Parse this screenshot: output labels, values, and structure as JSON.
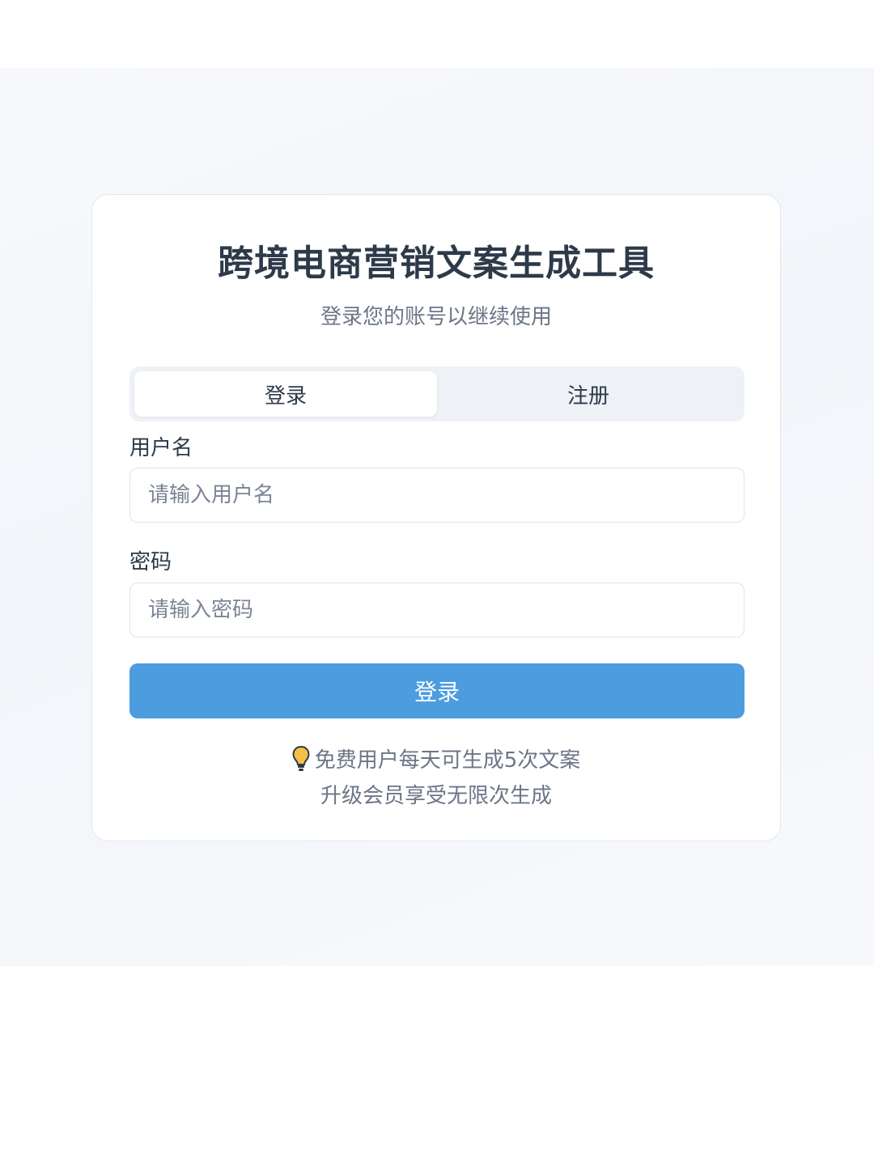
{
  "app": {
    "title": "跨境电商营销文案生成工具",
    "subtitle": "登录您的账号以继续使用"
  },
  "tabs": [
    {
      "label": "登录",
      "active": true
    },
    {
      "label": "注册",
      "active": false
    }
  ],
  "form": {
    "username_label": "用户名",
    "username_placeholder": "请输入用户名",
    "username_value": "",
    "password_label": "密码",
    "password_placeholder": "请输入密码",
    "password_value": "",
    "submit_label": "登录"
  },
  "tips": {
    "icon": "lightbulb-icon",
    "line1": "免费用户每天可生成5次文案",
    "line2": "升级会员享受无限次生成"
  },
  "colors": {
    "primary": "#4c9ddf",
    "title": "#2d3a4a",
    "muted": "#6b7686",
    "tab_bg": "#eef2f7",
    "bulb": "#f5c144"
  }
}
